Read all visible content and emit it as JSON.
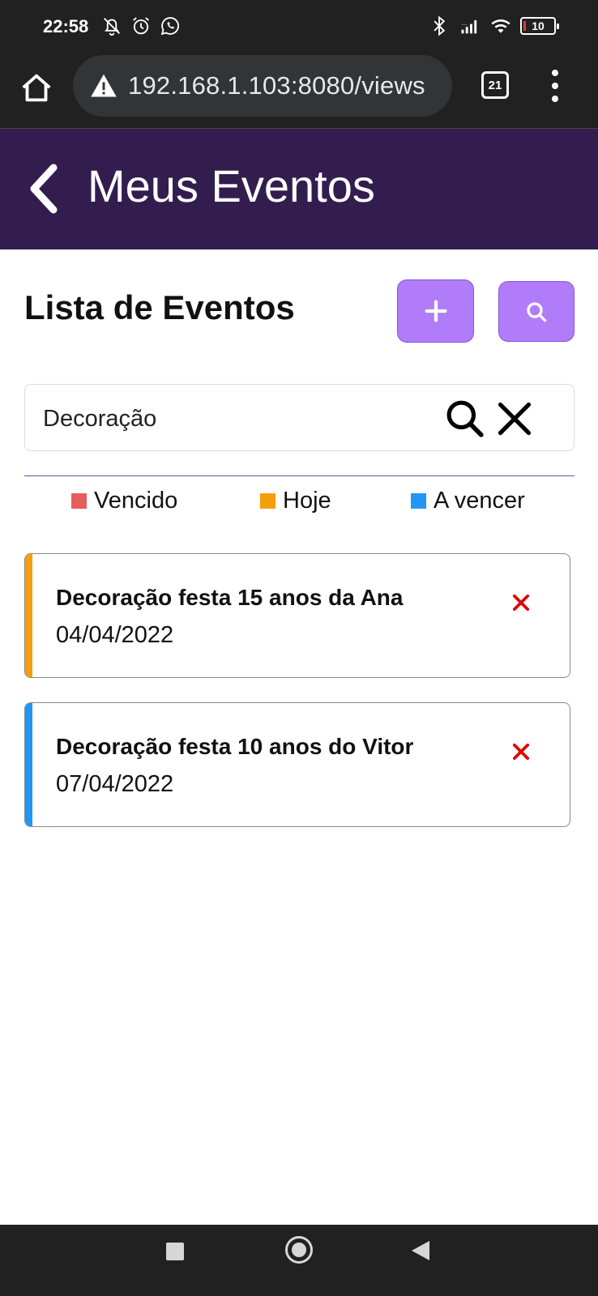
{
  "status_bar": {
    "time": "22:58",
    "left_icons": [
      "notifications-off-icon",
      "alarm-icon",
      "whatsapp-icon"
    ],
    "right_icons": [
      "bluetooth-icon",
      "signal-icon",
      "wifi-icon"
    ],
    "battery": "10"
  },
  "browser": {
    "url": "192.168.1.103:8080/views",
    "tab_count": "21"
  },
  "app_header": {
    "title": "Meus Eventos"
  },
  "main": {
    "list_title": "Lista de Eventos",
    "search": {
      "value": "Decoração"
    },
    "legend": [
      {
        "label": "Vencido",
        "color": "#e55c61"
      },
      {
        "label": "Hoje",
        "color": "#f59e0b"
      },
      {
        "label": "A vencer",
        "color": "#2196f3"
      }
    ],
    "events": [
      {
        "title": "Decoração festa 15 anos da Ana",
        "date": "04/04/2022",
        "status_color": "#f59e0b"
      },
      {
        "title": "Decoração festa 10 anos do Vitor",
        "date": "07/04/2022",
        "status_color": "#2196f3"
      }
    ]
  },
  "colors": {
    "header_bg": "#331d4f",
    "button_bg": "#b17cf9",
    "delete": "#e00000"
  }
}
